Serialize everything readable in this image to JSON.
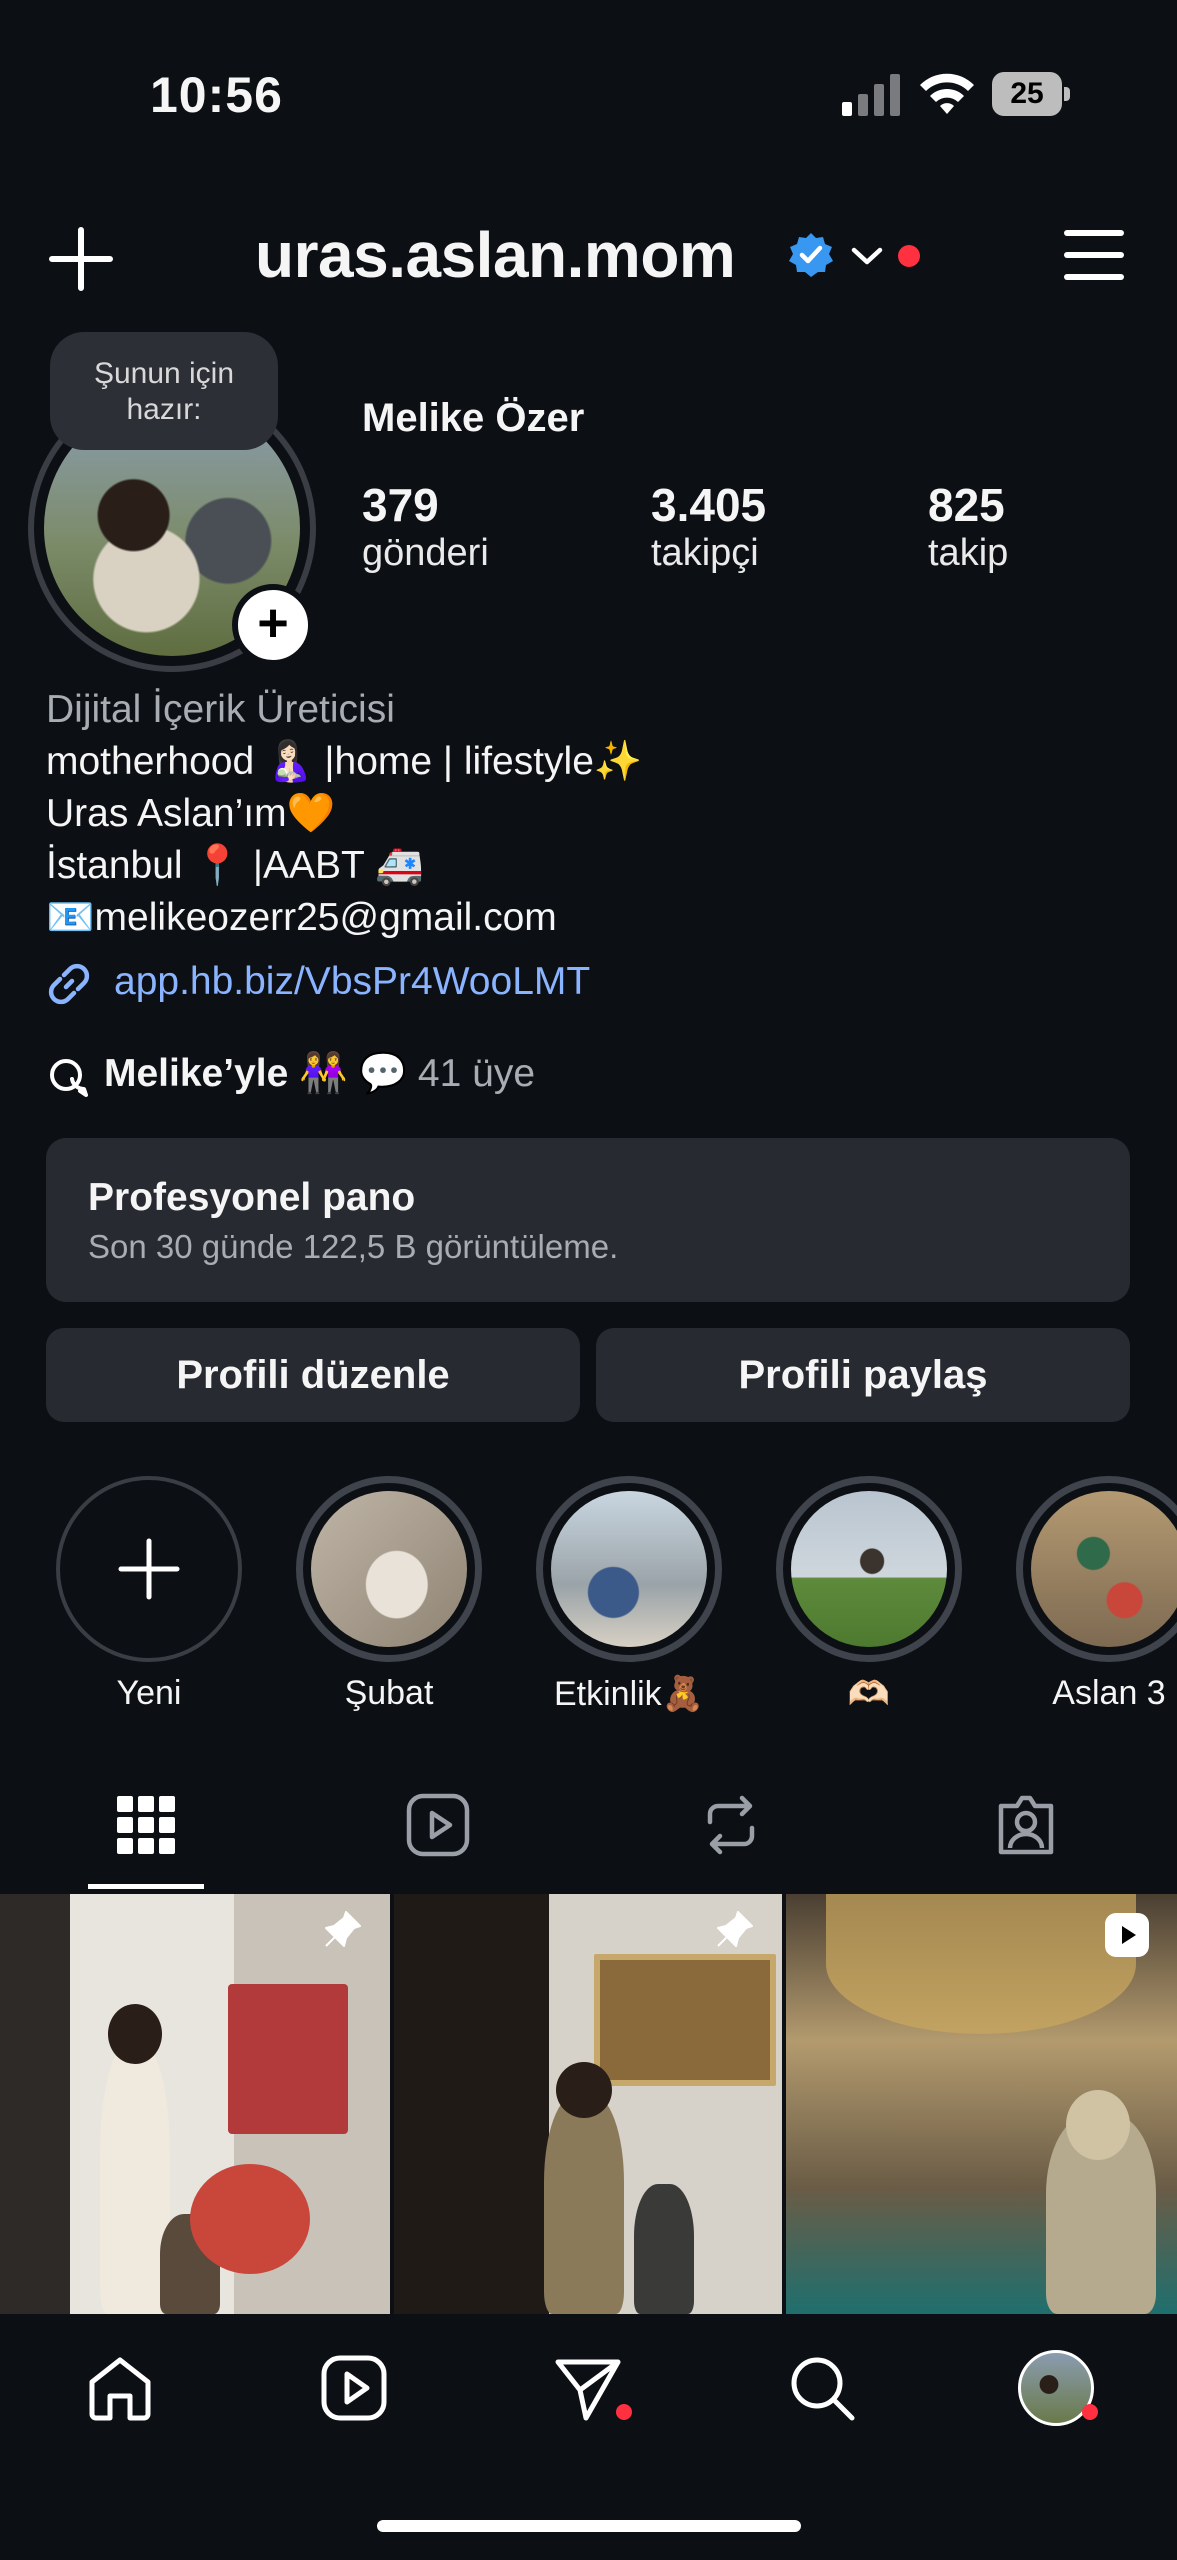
{
  "status_bar": {
    "time": "10:56",
    "battery": "25"
  },
  "header": {
    "username": "uras.aslan.mom"
  },
  "profile": {
    "tooltip": [
      "Şunun için",
      "hazır:"
    ],
    "display_name": "Melike Özer",
    "stats": [
      {
        "value": "379",
        "label": "gönderi"
      },
      {
        "value": "3.405",
        "label": "takipçi"
      },
      {
        "value": "825",
        "label": "takip"
      }
    ]
  },
  "bio": {
    "category": "Dijital İçerik Üreticisi",
    "lines": [
      "motherhood 🤱🏻 |home | lifestyle✨",
      "Uras Aslan’ım🧡",
      "İstanbul 📍 |AABT 🚑",
      "📧melikeozerr25@gmail.com"
    ],
    "link": "app.hb.biz/VbsPr4WooLMT",
    "channel_name": "Melike’yle 👭 💬",
    "channel_members": "41 üye"
  },
  "dashboard": {
    "title": "Profesyonel pano",
    "subtitle": "Son 30 günde 122,5 B görüntüleme."
  },
  "buttons": {
    "edit": "Profili düzenle",
    "share": "Profili paylaş"
  },
  "highlights": [
    {
      "label": "Yeni"
    },
    {
      "label": "Şubat"
    },
    {
      "label": "Etkinlik🧸"
    },
    {
      "label": "🫶🏻"
    },
    {
      "label": "Aslan 3"
    }
  ],
  "icons": {
    "status": [
      "signal-icon",
      "wifi-icon",
      "battery-icon"
    ],
    "header": [
      "plus-icon",
      "verified-badge-icon",
      "chevron-down-icon",
      "menu-icon"
    ],
    "tabs": [
      "grid-icon",
      "reels-icon",
      "reposts-icon",
      "tagged-icon"
    ],
    "nav": [
      "home-icon",
      "reels-icon",
      "direct-icon",
      "search-icon",
      "profile-avatar"
    ]
  },
  "colors": {
    "background": "#0c0f14",
    "accent_link": "#8ab4ff",
    "verified": "#3897f0",
    "notification": "#ff3040",
    "card": "#272a31"
  }
}
